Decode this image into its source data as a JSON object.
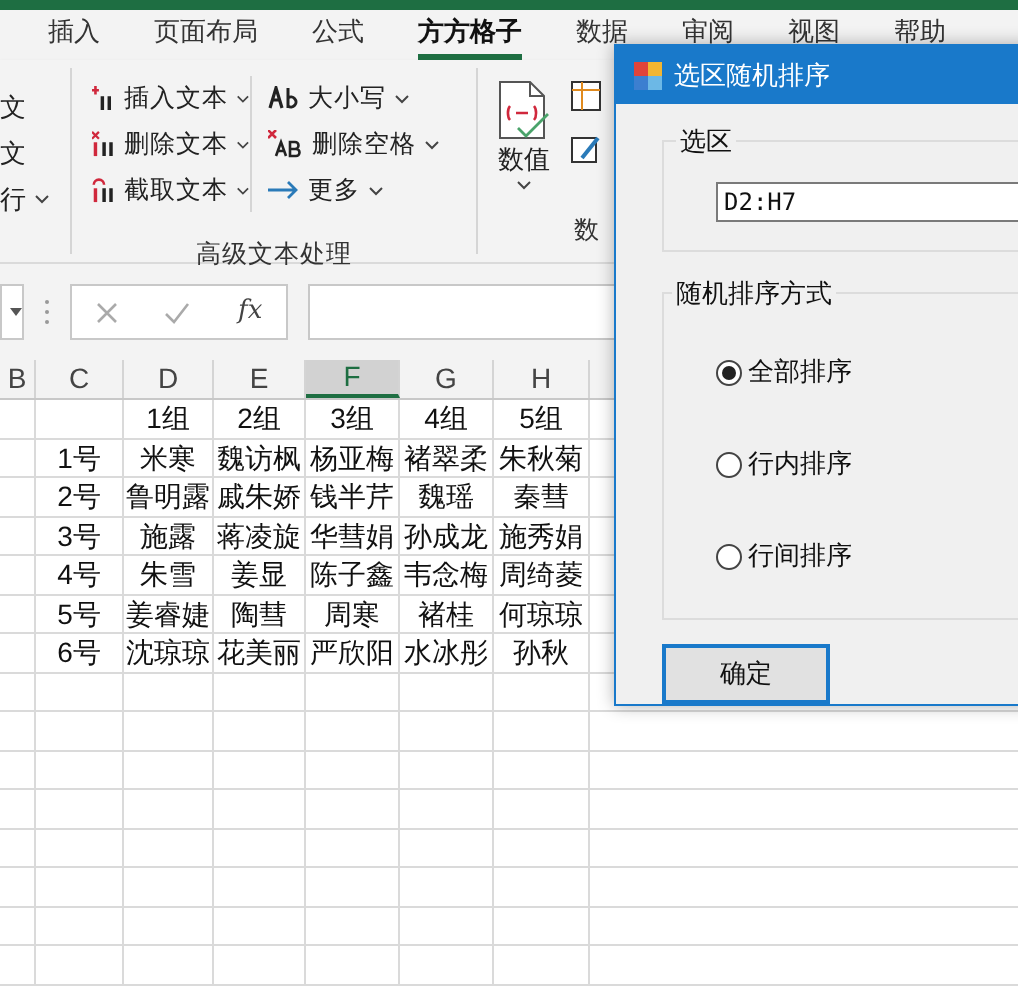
{
  "tabs": [
    {
      "label": "插入",
      "selected": false
    },
    {
      "label": "页面布局",
      "selected": false
    },
    {
      "label": "公式",
      "selected": false
    },
    {
      "label": "方方格子",
      "selected": true
    },
    {
      "label": "数据",
      "selected": false
    },
    {
      "label": "审阅",
      "selected": false
    },
    {
      "label": "视图",
      "selected": false
    },
    {
      "label": "帮助",
      "selected": false
    }
  ],
  "ribbon": {
    "partial_items": [
      "文",
      "文",
      "行"
    ],
    "text_group": {
      "label": "高级文本处理",
      "column_1": [
        {
          "label": "插入文本",
          "kind": "insert"
        },
        {
          "label": "删除文本",
          "kind": "delete"
        },
        {
          "label": "截取文本",
          "kind": "extract"
        }
      ],
      "column_2": [
        {
          "label": "大小写",
          "kind": "case"
        },
        {
          "label": "删除空格",
          "kind": "space"
        },
        {
          "label": "更多",
          "kind": "more"
        }
      ]
    },
    "number_button": "数值",
    "number_group_label": "数"
  },
  "formula_bar": {
    "fx": "fx"
  },
  "sheet": {
    "columns": [
      {
        "label": "B",
        "selected": false
      },
      {
        "label": "C",
        "selected": false
      },
      {
        "label": "D",
        "selected": false
      },
      {
        "label": "E",
        "selected": false
      },
      {
        "label": "F",
        "selected": true
      },
      {
        "label": "G",
        "selected": false
      },
      {
        "label": "H",
        "selected": false
      }
    ],
    "rows": [
      [
        "",
        "",
        "1组",
        "2组",
        "3组",
        "4组",
        "5组"
      ],
      [
        "",
        "1号",
        "米寒",
        "魏访枫",
        "杨亚梅",
        "褚翠柔",
        "朱秋菊"
      ],
      [
        "",
        "2号",
        "鲁明露",
        "戚朱娇",
        "钱半芹",
        "魏瑶",
        "秦彗"
      ],
      [
        "",
        "3号",
        "施露",
        "蒋凌旋",
        "华彗娟",
        "孙成龙",
        "施秀娟"
      ],
      [
        "",
        "4号",
        "朱雪",
        "姜显",
        "陈子鑫",
        "韦念梅",
        "周绮菱"
      ],
      [
        "",
        "5号",
        "姜睿婕",
        "陶彗",
        "周寒",
        "褚桂",
        "何琼琼"
      ],
      [
        "",
        "6号",
        "沈琼琼",
        "花美丽",
        "严欣阳",
        "水冰彤",
        "孙秋"
      ]
    ]
  },
  "dialog": {
    "title": "选区随机排序",
    "range_group": "选区",
    "range_value": "D2:H7",
    "mode_group": "随机排序方式",
    "modes": [
      {
        "label": "全部排序",
        "selected": true
      },
      {
        "label": "行内排序",
        "selected": false
      },
      {
        "label": "行间排序",
        "selected": false
      }
    ],
    "ok_button": "确定"
  }
}
